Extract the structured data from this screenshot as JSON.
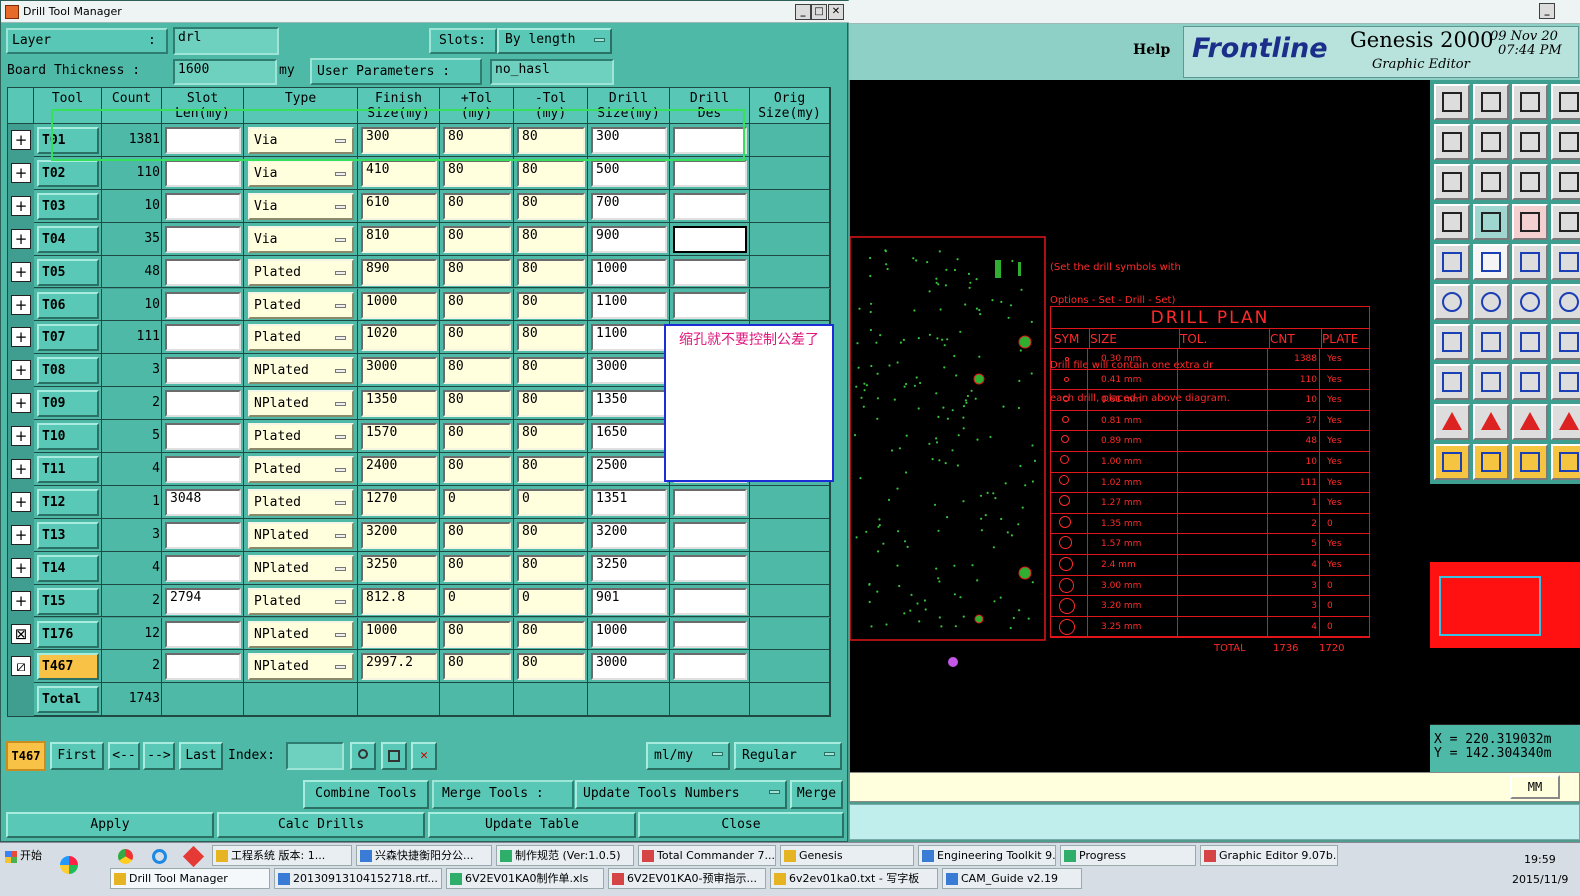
{
  "window": {
    "title": "Drill Tool Manager"
  },
  "layer": {
    "label": "Layer",
    "value": "drl",
    "slots_label": "Slots:",
    "slots_value": "By length"
  },
  "board": {
    "label": "Board Thickness :",
    "value": "1600",
    "unit": "my",
    "user_params_label": "User Parameters :",
    "user_params_value": "no_hasl"
  },
  "columns": [
    "Tool",
    "Count",
    "Slot\nLen(my)",
    "Type",
    "Finish\nSize(my)",
    "+Tol\n(my)",
    "-Tol\n(my)",
    "Drill\nSize(my)",
    "Drill\nDes",
    "Orig\nSize(my)"
  ],
  "rows": [
    {
      "tool": "T01",
      "count": "1381",
      "slot": "",
      "type": "Via",
      "finish": "300",
      "ptol": "80",
      "ntol": "80",
      "drill": "300",
      "des": ""
    },
    {
      "tool": "T02",
      "count": "110",
      "slot": "",
      "type": "Via",
      "finish": "410",
      "ptol": "80",
      "ntol": "80",
      "drill": "500",
      "des": ""
    },
    {
      "tool": "T03",
      "count": "10",
      "slot": "",
      "type": "Via",
      "finish": "610",
      "ptol": "80",
      "ntol": "80",
      "drill": "700",
      "des": ""
    },
    {
      "tool": "T04",
      "count": "35",
      "slot": "",
      "type": "Via",
      "finish": "810",
      "ptol": "80",
      "ntol": "80",
      "drill": "900",
      "des": ""
    },
    {
      "tool": "T05",
      "count": "48",
      "slot": "",
      "type": "Plated",
      "finish": "890",
      "ptol": "80",
      "ntol": "80",
      "drill": "1000",
      "des": ""
    },
    {
      "tool": "T06",
      "count": "10",
      "slot": "",
      "type": "Plated",
      "finish": "1000",
      "ptol": "80",
      "ntol": "80",
      "drill": "1100",
      "des": ""
    },
    {
      "tool": "T07",
      "count": "111",
      "slot": "",
      "type": "Plated",
      "finish": "1020",
      "ptol": "80",
      "ntol": "80",
      "drill": "1100",
      "des": ""
    },
    {
      "tool": "T08",
      "count": "3",
      "slot": "",
      "type": "NPlated",
      "finish": "3000",
      "ptol": "80",
      "ntol": "80",
      "drill": "3000",
      "des": ""
    },
    {
      "tool": "T09",
      "count": "2",
      "slot": "",
      "type": "NPlated",
      "finish": "1350",
      "ptol": "80",
      "ntol": "80",
      "drill": "1350",
      "des": ""
    },
    {
      "tool": "T10",
      "count": "5",
      "slot": "",
      "type": "Plated",
      "finish": "1570",
      "ptol": "80",
      "ntol": "80",
      "drill": "1650",
      "des": ""
    },
    {
      "tool": "T11",
      "count": "4",
      "slot": "",
      "type": "Plated",
      "finish": "2400",
      "ptol": "80",
      "ntol": "80",
      "drill": "2500",
      "des": ""
    },
    {
      "tool": "T12",
      "count": "1",
      "slot": "3048",
      "type": "Plated",
      "finish": "1270",
      "ptol": "0",
      "ntol": "0",
      "drill": "1351",
      "des": ""
    },
    {
      "tool": "T13",
      "count": "3",
      "slot": "",
      "type": "NPlated",
      "finish": "3200",
      "ptol": "80",
      "ntol": "80",
      "drill": "3200",
      "des": ""
    },
    {
      "tool": "T14",
      "count": "4",
      "slot": "",
      "type": "NPlated",
      "finish": "3250",
      "ptol": "80",
      "ntol": "80",
      "drill": "3250",
      "des": ""
    },
    {
      "tool": "T15",
      "count": "2",
      "slot": "2794",
      "type": "Plated",
      "finish": "812.8",
      "ptol": "0",
      "ntol": "0",
      "drill": "901",
      "des": ""
    },
    {
      "tool": "T176",
      "count": "12",
      "slot": "",
      "type": "NPlated",
      "finish": "1000",
      "ptol": "80",
      "ntol": "80",
      "drill": "1000",
      "des": ""
    },
    {
      "tool": "T467",
      "count": "2",
      "slot": "",
      "type": "NPlated",
      "finish": "2997.2",
      "ptol": "80",
      "ntol": "80",
      "drill": "3000",
      "des": ""
    }
  ],
  "total": {
    "label": "Total",
    "count": "1743"
  },
  "note": {
    "text": "缩孔就不要控制公差了"
  },
  "nav": {
    "current": "T467",
    "first": "First",
    "prev": "<--",
    "next": "-->",
    "last": "Last",
    "index_label": "Index:",
    "units": "ml/my",
    "mode": "Regular"
  },
  "actions": {
    "combine": "Combine Tools",
    "merge_label": "Merge Tools :",
    "update_numbers": "Update Tools Numbers",
    "merge": "Merge"
  },
  "bottom": {
    "apply": "Apply",
    "calc": "Calc Drills",
    "update": "Update Table",
    "close": "Close"
  },
  "genesis": {
    "help": "Help",
    "brand": "Frontline",
    "product": "Genesis 2000",
    "subtitle": "Graphic Editor",
    "date": "09 Nov 20",
    "time": "07:44 PM"
  },
  "drill_note": {
    "line1": "(Set the drill symbols with",
    "line2": "Options - Set - Drill - Set)",
    "line3": "Drill file will contain one extra dr",
    "line4": "each drill, placed in above diagram."
  },
  "drill_plan": {
    "title": "DRILL PLAN",
    "headers": [
      "SYM",
      "SIZE",
      "TOL.",
      "CNT",
      "PLATE"
    ],
    "rows": [
      {
        "size": "0.30 mm",
        "cnt": "1388",
        "plate": "Yes"
      },
      {
        "size": "0.41 mm",
        "cnt": "110",
        "plate": "Yes"
      },
      {
        "size": "0.61 mm",
        "cnt": "10",
        "plate": "Yes"
      },
      {
        "size": "0.81 mm",
        "cnt": "37",
        "plate": "Yes"
      },
      {
        "size": "0.89 mm",
        "cnt": "48",
        "plate": "Yes"
      },
      {
        "size": "1.00 mm",
        "cnt": "10",
        "plate": "Yes"
      },
      {
        "size": "1.02 mm",
        "cnt": "111",
        "plate": "Yes"
      },
      {
        "size": "1.27 mm",
        "cnt": "1",
        "plate": "Yes"
      },
      {
        "size": "1.35 mm",
        "cnt": "2",
        "plate": "0"
      },
      {
        "size": "1.57 mm",
        "cnt": "5",
        "plate": "Yes"
      },
      {
        "size": "2.4  mm",
        "cnt": "4",
        "plate": "Yes"
      },
      {
        "size": "3.00 mm",
        "cnt": "3",
        "plate": "0"
      },
      {
        "size": "3.20 mm",
        "cnt": "3",
        "plate": "0"
      },
      {
        "size": "3.25 mm",
        "cnt": "4",
        "plate": "0"
      }
    ],
    "total_label": "TOTAL",
    "total_a": "1736",
    "total_b": "1720"
  },
  "coords": {
    "x": "X  = 220.319032m",
    "y": "Y  = 142.304340m",
    "unit": "MM"
  },
  "taskbar": {
    "start": "开始",
    "row1": [
      "工程系统  版本: 1...",
      "兴森快捷衡阳分公...",
      "制作规范 (Ver:1.0.5)",
      "Total Commander 7....",
      "Genesis",
      "Engineering Toolkit 9...",
      "Progress",
      "Graphic Editor 9.07b..."
    ],
    "row2": [
      "Drill Tool Manager",
      "20130913104152718.rtf...",
      "6V2EV01KA0制作单.xls",
      "6V2EV01KA0-预审指示...",
      "6v2ev01ka0.txt - 写字板",
      "CAM_Guide v2.19"
    ],
    "clock": "19:59",
    "date": "2015/11/9"
  }
}
